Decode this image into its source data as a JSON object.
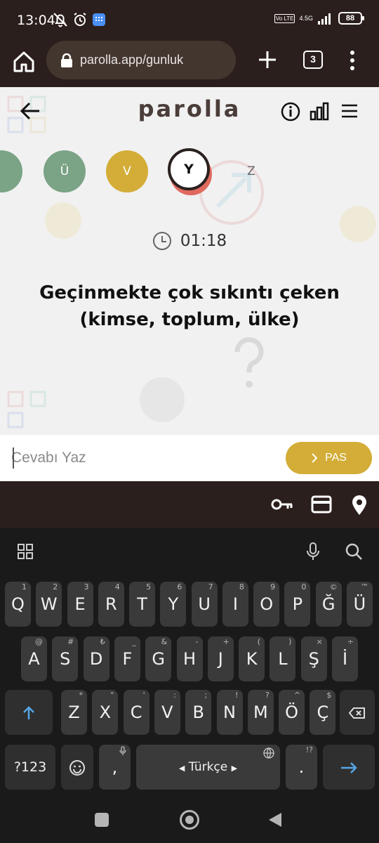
{
  "status_bar": {
    "time": "13:04",
    "network_type": "4.5G",
    "lte_label": "Vo LTE",
    "battery": "88"
  },
  "browser": {
    "url": "parolla.app/gunluk",
    "tab_count": "3"
  },
  "app": {
    "logo": "parolla",
    "letters": [
      {
        "label": "Ü",
        "state": "correct",
        "color": "#7ba386"
      },
      {
        "label": "V",
        "state": "passed",
        "color": "#d3ad37"
      },
      {
        "label": "Y",
        "state": "current",
        "color": "#ffffff"
      },
      {
        "label": "Z",
        "state": "upcoming",
        "color": "#f1f1f1"
      }
    ],
    "timer": "01:18",
    "question": "Geçinmekte çok sıkıntı çeken (kimse, toplum, ülke)",
    "answer_placeholder": "Cevabı Yaz",
    "pass_label": "PAS"
  },
  "keyboard": {
    "row1": [
      {
        "k": "Q",
        "h": "1"
      },
      {
        "k": "W",
        "h": "2"
      },
      {
        "k": "E",
        "h": "3"
      },
      {
        "k": "R",
        "h": "4"
      },
      {
        "k": "T",
        "h": "5"
      },
      {
        "k": "Y",
        "h": "6"
      },
      {
        "k": "U",
        "h": "7"
      },
      {
        "k": "I",
        "h": "8"
      },
      {
        "k": "O",
        "h": "9"
      },
      {
        "k": "P",
        "h": "0"
      },
      {
        "k": "Ğ",
        "h": "©"
      },
      {
        "k": "Ü",
        "h": "™"
      }
    ],
    "row2": [
      {
        "k": "A",
        "h": "@"
      },
      {
        "k": "S",
        "h": "#"
      },
      {
        "k": "D",
        "h": "₺"
      },
      {
        "k": "F",
        "h": "_"
      },
      {
        "k": "G",
        "h": "&"
      },
      {
        "k": "H",
        "h": "-"
      },
      {
        "k": "J",
        "h": "+"
      },
      {
        "k": "K",
        "h": "("
      },
      {
        "k": "L",
        "h": ")"
      },
      {
        "k": "Ş",
        "h": "×"
      },
      {
        "k": "İ",
        "h": "÷"
      }
    ],
    "row3": [
      {
        "k": "Z",
        "h": "*"
      },
      {
        "k": "X",
        "h": "\""
      },
      {
        "k": "C",
        "h": "'"
      },
      {
        "k": "V",
        "h": ":"
      },
      {
        "k": "B",
        "h": ";"
      },
      {
        "k": "N",
        "h": "!"
      },
      {
        "k": "M",
        "h": "?"
      },
      {
        "k": "Ö",
        "h": "^"
      },
      {
        "k": "Ç",
        "h": "$"
      }
    ],
    "symbols_label": "?123",
    "comma_label": ",",
    "space_label": "Türkçe",
    "period_label": ".",
    "period_hint": "!?"
  },
  "icons": {
    "status": [
      "mute-icon",
      "alarm-icon",
      "app-notification-icon",
      "signal-icon",
      "battery-icon"
    ],
    "browser": [
      "home-icon",
      "lock-icon",
      "new-tab-icon",
      "tabs-icon",
      "more-icon"
    ],
    "app_header": [
      "back-arrow-icon",
      "info-icon",
      "stats-icon",
      "menu-icon"
    ],
    "autofill": [
      "key-icon",
      "card-icon",
      "location-icon"
    ]
  },
  "colors": {
    "correct": "#7ba386",
    "passed": "#d3ad37",
    "current_shadow": "#e06a5f",
    "logo": "#4a3d3a",
    "chrome": "#2b1f1d",
    "enter_key": "#57a6e6"
  }
}
